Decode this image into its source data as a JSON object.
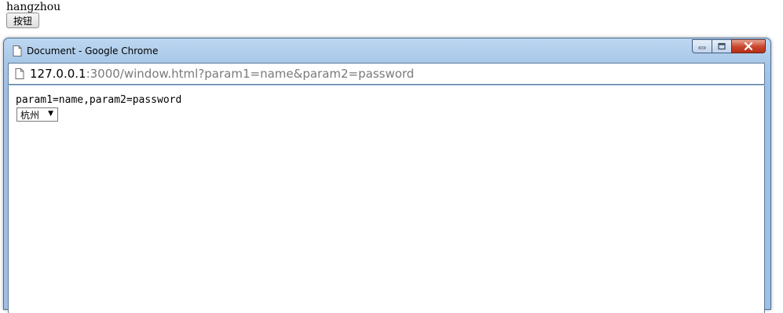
{
  "page": {
    "text": "hangzhou",
    "button_label": "按钮"
  },
  "popup": {
    "title": "Document - Google Chrome",
    "url": {
      "host": "127.0.0.1",
      "rest": ":3000/window.html?param1=name&param2=password"
    },
    "content": {
      "result_text": "param1=name,param2=password",
      "select_value": "杭州"
    }
  },
  "icons": {
    "page": "document-icon",
    "minimize": "minimize-icon",
    "maximize": "maximize-icon",
    "close": "close-icon"
  },
  "colors": {
    "titlebar": "#a9c8e8",
    "close_button": "#c7442a",
    "url_rest": "#7a7a7a"
  }
}
